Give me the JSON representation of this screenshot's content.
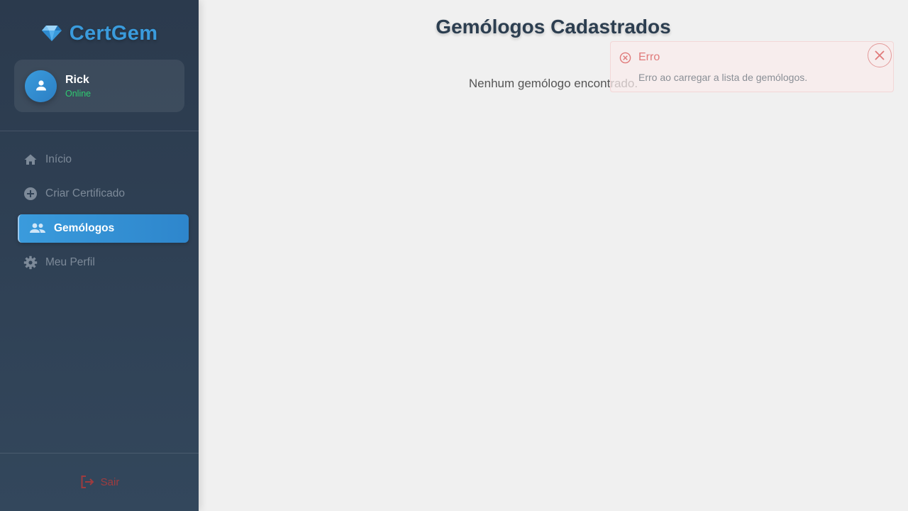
{
  "brand": {
    "name": "CertGem",
    "icon": "diamond-icon"
  },
  "user": {
    "name": "Rick",
    "status": "Online",
    "avatar_icon": "user-icon"
  },
  "nav": {
    "items": [
      {
        "label": "Início",
        "icon": "home-icon",
        "active": false
      },
      {
        "label": "Criar Certificado",
        "icon": "plus-circle-icon",
        "active": false
      },
      {
        "label": "Gemólogos",
        "icon": "people-icon",
        "active": true
      },
      {
        "label": "Meu Perfil",
        "icon": "gear-icon",
        "active": false
      }
    ]
  },
  "logout": {
    "label": "Sair",
    "icon": "logout-icon"
  },
  "main": {
    "title": "Gemólogos Cadastrados",
    "empty_message": "Nenhum gemólogo encontrado."
  },
  "toast": {
    "title": "Erro",
    "message": "Erro ao carregar a lista de gemólogos.",
    "icon": "error-circle-icon",
    "close_icon": "close-icon"
  },
  "colors": {
    "accent": "#3a9bdc",
    "sidebar": "#2f4155",
    "online": "#2ecc71",
    "error": "#e07a7a",
    "logout": "#b23a3a"
  }
}
